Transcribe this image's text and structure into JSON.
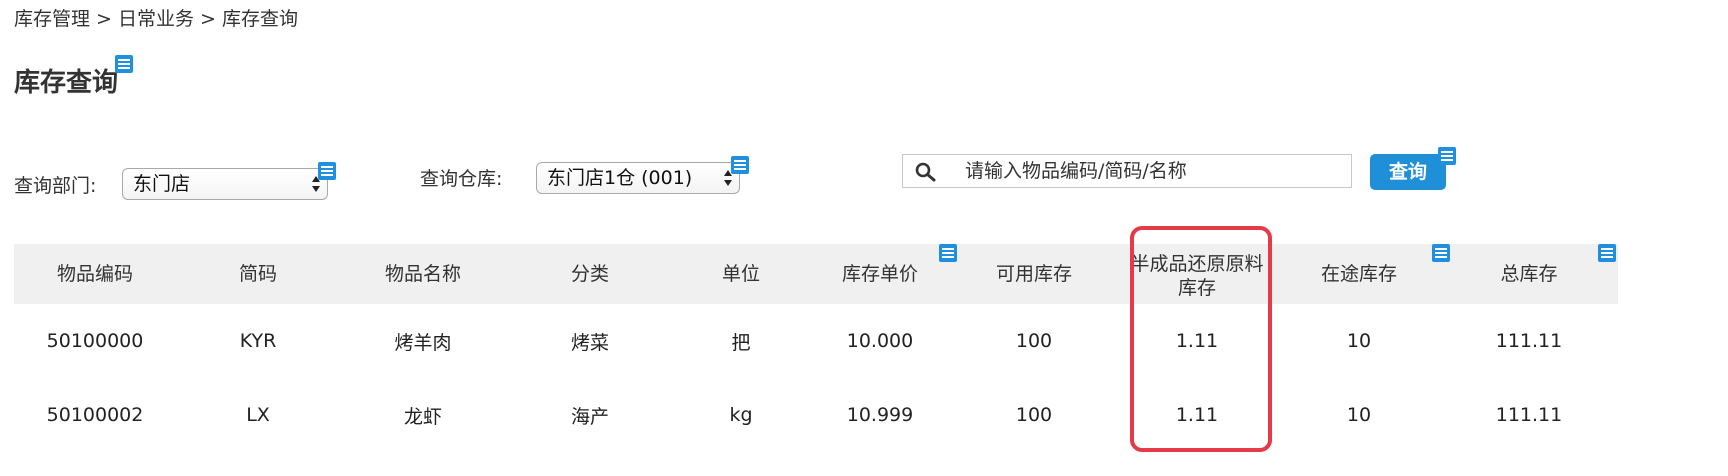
{
  "breadcrumb": "库存管理 > 日常业务 > 库存查询",
  "page_title": "库存查询",
  "filters": {
    "dept_label": "查询部门:",
    "dept_value": "东门店",
    "warehouse_label": "查询仓库:",
    "warehouse_value": "东门店1仓 (001)"
  },
  "search": {
    "placeholder": "请输入物品编码/简码/名称",
    "value": ""
  },
  "query_button": "查询",
  "table": {
    "headers": [
      "物品编码",
      "简码",
      "物品名称",
      "分类",
      "单位",
      "库存单价",
      "可用库存",
      "半成品还原原料\n库存",
      "在途库存",
      "总库存"
    ],
    "rows": [
      [
        "50100000",
        "KYR",
        "烤羊肉",
        "烤菜",
        "把",
        "10.000",
        "100",
        "1.11",
        "10",
        "111.11"
      ],
      [
        "50100002",
        "LX",
        "龙虾",
        "海产",
        "kg",
        "10.999",
        "100",
        "1.11",
        "10",
        "111.11"
      ]
    ]
  },
  "colors": {
    "accent": "#1f8fd8",
    "highlight": "#e53a48",
    "header_bg": "#f0f0f0"
  }
}
